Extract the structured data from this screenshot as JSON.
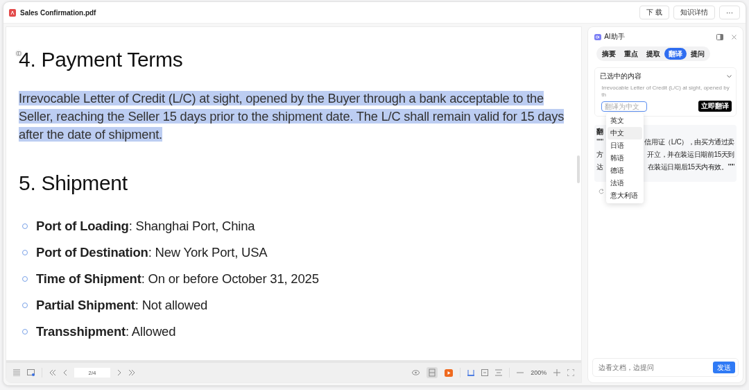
{
  "window": {
    "title": "Sales Confirmation.pdf",
    "buttons": [
      {
        "label": "下 载"
      },
      {
        "label": "知识详情"
      },
      {
        "label": "···"
      }
    ]
  },
  "document": {
    "sections": [
      {
        "heading": "4. Payment Terms",
        "paragraphs": [
          {
            "text": "Irrevocable Letter of Credit (L/C) at sight, opened by the Buyer through a bank acceptable to the Seller, reaching the Seller 15 days prior to the shipment date. The L/C shall remain valid for 15 days after the date of shipment.",
            "highlighted": true
          }
        ]
      },
      {
        "heading": "5. Shipment",
        "bullets": [
          "**Port of Loading**: Shanghai Port, China",
          "**Port of Destination**: New York Port, USA",
          "**Time of Shipment**: On or before October 31, 2025",
          "**Partial Shipment**: Not allowed",
          "**Transshipment**: Allowed"
        ]
      }
    ]
  },
  "toolbar": {
    "page": "2/4",
    "zoom": "200%"
  },
  "assistant": {
    "title": "AI助手",
    "tabs": [
      {
        "label": "摘要",
        "selected": false
      },
      {
        "label": "重点",
        "selected": false
      },
      {
        "label": "提取",
        "selected": false
      },
      {
        "label": "翻译",
        "selected": true
      },
      {
        "label": "提问",
        "selected": false
      }
    ],
    "selection": {
      "title": "已选中的内容",
      "expanded": true,
      "excerpt": "Irrevocable Letter of Credit (L/C) at sight, opened by th",
      "target_placeholder": "翻译为中文",
      "translate_button": "立即翻译"
    },
    "languages": [
      {
        "label": "英文",
        "selected": false
      },
      {
        "label": "中文",
        "selected": true
      },
      {
        "label": "日语",
        "selected": false
      },
      {
        "label": "韩语",
        "selected": false
      },
      {
        "label": "德语",
        "selected": false
      },
      {
        "label": "法语",
        "selected": false
      },
      {
        "label": "意大利语",
        "selected": false
      }
    ],
    "result": {
      "heading": "翻",
      "lines": [
        {
          "left": "\"\"\"",
          "right": "信用证（L/C），由买方通过卖"
        },
        {
          "left": "方",
          "right": "开立，并在装运日期前15天到"
        },
        {
          "left": "达",
          "right": "在装运日期后15天内有效。\"\"\""
        }
      ]
    },
    "question_placeholder": "边看文档，边提问",
    "send_button": "发送"
  }
}
